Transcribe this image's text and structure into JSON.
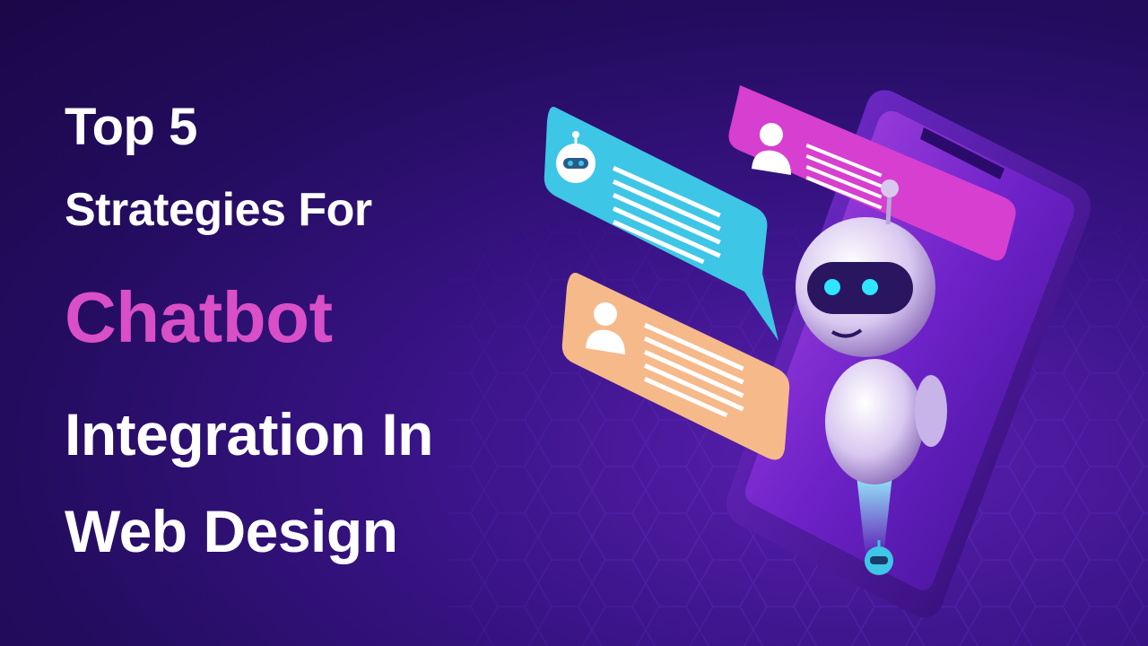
{
  "headline": {
    "line1": "Top 5",
    "line2": "Strategies For",
    "highlight": "Chatbot",
    "line4": "Integration In",
    "line5": "Web Design"
  },
  "colors": {
    "background": "#2a0d6e",
    "highlight": "#d94fc7",
    "bubble_cyan": "#3ec6e6",
    "bubble_pink": "#d63fd0",
    "bubble_peach": "#f6b98a",
    "robot_eye": "#2ee6ff"
  },
  "icons": [
    "hexagon-grid-background",
    "smartphone",
    "robot",
    "chat-bubble-robot",
    "chat-bubble-user",
    "user-avatar-icon",
    "robot-avatar-icon"
  ]
}
